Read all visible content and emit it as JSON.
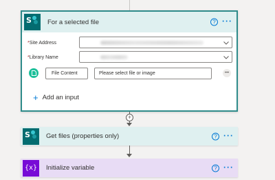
{
  "trigger": {
    "title": "For a selected file",
    "help_glyph": "?",
    "more_glyph": "···",
    "fields": {
      "site_address": {
        "required_mark": "*",
        "label": "Site Address"
      },
      "library_name": {
        "required_mark": "*",
        "label": "Library Name"
      }
    },
    "file_input": {
      "key": "File Content",
      "placeholder": "Please select file or image"
    },
    "add_input_label": "Add an input"
  },
  "actions": [
    {
      "title": "Get files (properties only)",
      "icon": "sharepoint-icon"
    },
    {
      "title": "Initialize variable",
      "icon": "variable-icon",
      "icon_glyph": "{x}"
    }
  ],
  "colors": {
    "sharepoint": "#036c70",
    "sharepoint_header": "#dff0f0",
    "variable": "#770bd6",
    "variable_header": "#e8dcf5",
    "accent": "#0078d4",
    "file_icon": "#1dbf9a"
  }
}
